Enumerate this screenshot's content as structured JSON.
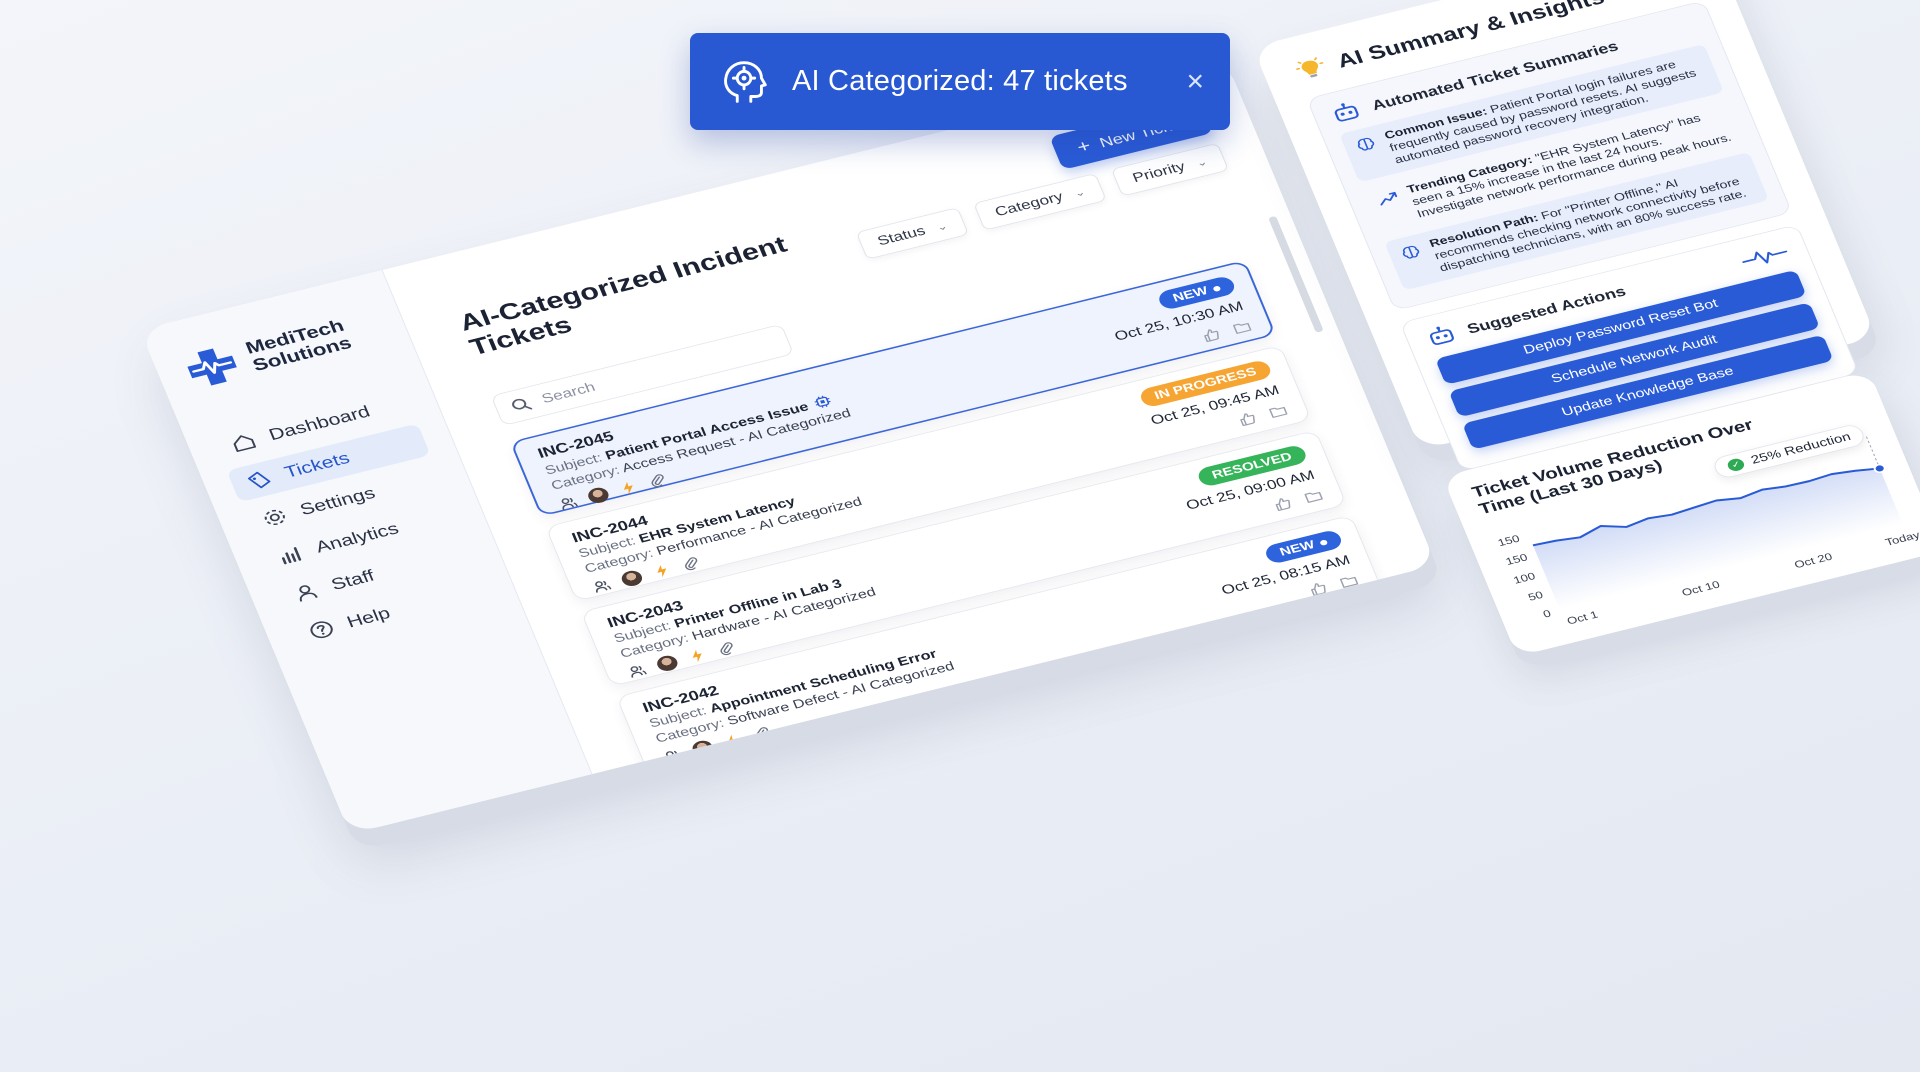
{
  "toast": {
    "text": "AI Categorized: 47 tickets",
    "close": "×",
    "icon": "brain-gear-icon"
  },
  "brand": {
    "name": "MediTech Solutions",
    "color": "#2a5bd6"
  },
  "sidebar": {
    "items": [
      {
        "label": "Dashboard",
        "icon": "home-icon"
      },
      {
        "label": "Tickets",
        "icon": "ticket-icon",
        "active": true
      },
      {
        "label": "Settings",
        "icon": "gear-icon"
      },
      {
        "label": "Analytics",
        "icon": "bar-chart-icon"
      },
      {
        "label": "Staff",
        "icon": "person-icon"
      },
      {
        "label": "Help",
        "icon": "help-icon"
      }
    ]
  },
  "main": {
    "title": "AI-Categorized Incident Tickets",
    "new_ticket": "New Ticket",
    "search_placeholder": "Search",
    "filters": [
      "Status",
      "Category",
      "Priority"
    ]
  },
  "tickets": [
    {
      "id": "INC-2045",
      "subject_label": "Subject:",
      "subject": "Patient Portal Access Issue",
      "category_label": "Category:",
      "category": "Access Request - AI Categorized",
      "status": "NEW",
      "status_kind": "new",
      "date": "Oct 25, 10:30 AM",
      "selected": true
    },
    {
      "id": "INC-2044",
      "subject_label": "Subject:",
      "subject": "EHR System Latency",
      "category_label": "Category:",
      "category": "Performance - AI Categorized",
      "status": "IN PROGRESS",
      "status_kind": "progress",
      "date": "Oct 25, 09:45 AM"
    },
    {
      "id": "INC-2043",
      "subject_label": "Subject:",
      "subject": "Printer Offline in Lab 3",
      "category_label": "Category:",
      "category": "Hardware - AI Categorized",
      "status": "RESOLVED",
      "status_kind": "resolved",
      "date": "Oct 25, 09:00 AM"
    },
    {
      "id": "INC-2042",
      "subject_label": "Subject:",
      "subject": "Appointment Scheduling Error",
      "category_label": "Category:",
      "category": "Software Defect - AI Categorized",
      "status": "NEW",
      "status_kind": "new",
      "date": "Oct 25, 08:15 AM"
    }
  ],
  "ai_panel": {
    "title": "AI Summary & Insights",
    "summaries_title": "Automated Ticket Summaries",
    "insights": [
      {
        "label": "Common Issue:",
        "text": "Patient Portal login failures are frequently caused by password resets. AI suggests automated password recovery integration.",
        "icon": "brain-icon"
      },
      {
        "label": "Trending Category:",
        "text": "\"EHR System Latency\" has seen a 15% increase in the last 24 hours. Investigate network performance during peak hours.",
        "icon": "trend-up-icon"
      },
      {
        "label": "Resolution Path:",
        "text": "For \"Printer Offline,\" AI recommends checking network connectivity before dispatching technicians, with an 80% success rate.",
        "icon": "brain-icon"
      }
    ],
    "actions_title": "Suggested Actions",
    "actions": [
      "Deploy Password Reset Bot",
      "Schedule Network Audit",
      "Update Knowledge Base"
    ]
  },
  "chart_data": {
    "type": "area",
    "title": "Ticket Volume Reduction Over Time (Last 30 Days)",
    "annotation": "25% Reduction",
    "y_tick_labels": [
      "150",
      "150",
      "100",
      "50",
      "0"
    ],
    "x_tick_labels": [
      "Oct 1",
      "Oct 10",
      "Oct 20",
      "Today"
    ],
    "x": [
      0,
      2,
      4,
      6,
      8,
      10,
      12,
      14,
      16,
      18,
      20,
      22,
      24,
      26,
      28,
      30
    ],
    "values": [
      135,
      133,
      128,
      140,
      126,
      132,
      128,
      131,
      134,
      127,
      133,
      128,
      127,
      130,
      125,
      118
    ],
    "ylim": [
      0,
      170
    ],
    "line_color": "#2a5bd6"
  }
}
